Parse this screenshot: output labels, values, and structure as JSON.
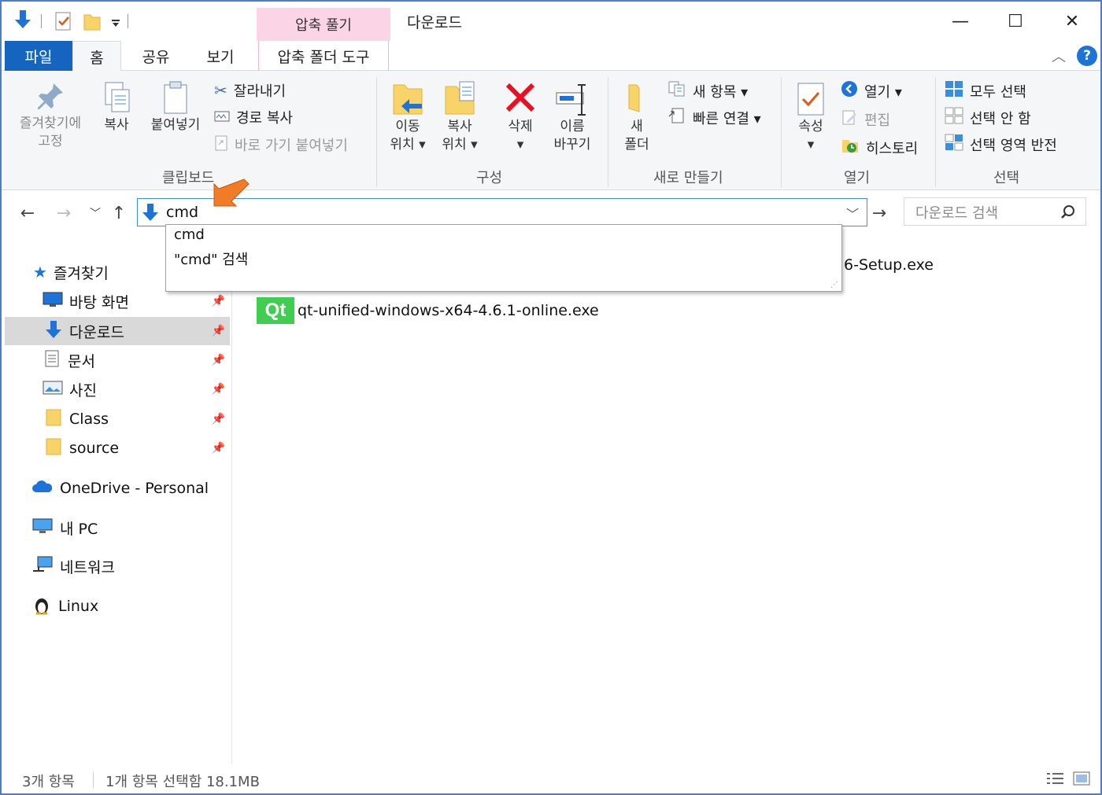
{
  "window": {
    "title": "다운로드",
    "context_tab": "압축 풀기",
    "controls": {
      "minimize": "—",
      "maximize": "☐",
      "close": "✕"
    }
  },
  "tabs": [
    {
      "label": "파일"
    },
    {
      "label": "홈"
    },
    {
      "label": "공유"
    },
    {
      "label": "보기"
    },
    {
      "label": "압축 폴더 도구"
    }
  ],
  "ribbon": {
    "clipboard": {
      "pin_line1": "즐겨찾기에",
      "pin_line2": "고정",
      "copy": "복사",
      "paste": "붙여넣기",
      "cut": "잘라내기",
      "copy_path": "경로 복사",
      "paste_shortcut": "바로 가기 붙여넣기",
      "label": "클립보드"
    },
    "organize": {
      "move_line1": "이동",
      "move_line2": "위치 ▾",
      "copy_line1": "복사",
      "copy_line2": "위치 ▾",
      "delete_line1": "삭제",
      "delete_line2": "▾",
      "rename_line1": "이름",
      "rename_line2": "바꾸기",
      "label": "구성"
    },
    "new": {
      "folder_line1": "새",
      "folder_line2": "폴더",
      "new_item": "새 항목 ▾",
      "easy_access": "빠른 연결 ▾",
      "label": "새로 만들기"
    },
    "open": {
      "properties_line1": "속성",
      "properties_line2": "▾",
      "open": "열기 ▾",
      "edit": "편집",
      "history": "히스토리",
      "label": "열기"
    },
    "select": {
      "select_all": "모두 선택",
      "select_none": "선택 안 함",
      "invert": "선택 영역 반전",
      "label": "선택"
    }
  },
  "address": {
    "value": "cmd",
    "search_placeholder": "다운로드 검색"
  },
  "dropdown": {
    "items": [
      "cmd",
      "\"cmd\" 검색"
    ]
  },
  "sidebar": {
    "quick_access": "즐겨찾기",
    "items": [
      {
        "label": "바탕 화면",
        "icon": "desktop-icon"
      },
      {
        "label": "다운로드",
        "icon": "download-icon"
      },
      {
        "label": "문서",
        "icon": "document-icon"
      },
      {
        "label": "사진",
        "icon": "picture-icon"
      },
      {
        "label": "Class",
        "icon": "folder-icon"
      },
      {
        "label": "source",
        "icon": "folder-icon"
      }
    ],
    "onedrive": "OneDrive - Personal",
    "this_pc": "내 PC",
    "network": "네트워크",
    "linux": "Linux"
  },
  "files": [
    {
      "name": "6-Setup.exe"
    },
    {
      "name": "qt-unified-windows-x64-4.6.1-online.exe",
      "icon_text": "Qt"
    }
  ],
  "status": {
    "count": "3개 항목",
    "selection": "1개 항목 선택함 18.1MB"
  },
  "colors": {
    "accent": "#1565c0",
    "context_tab": "#fbd5e6",
    "address_border": "#3a8ee6",
    "qt_green": "#41cd52",
    "delete_red": "#e81123",
    "arrow_orange": "#f07c27"
  }
}
